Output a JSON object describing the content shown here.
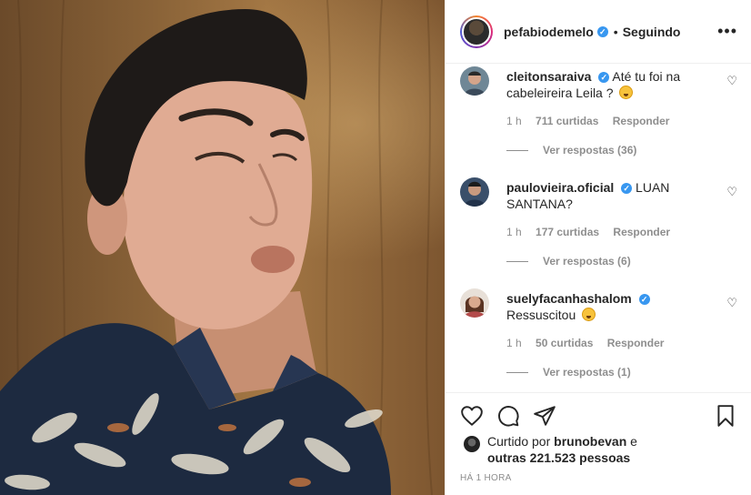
{
  "post": {
    "author": "pefabiodemelo",
    "follow_state": "Seguindo",
    "separator": "•",
    "more_label": "•••",
    "verified_mark": "✓",
    "time_ago": "HÁ 1 HORA"
  },
  "comments": [
    {
      "username": "cleitonsaraiva",
      "verified": true,
      "text": "Até tu foi na cabeleireira Leila ?",
      "emoji": "astonished-face-emoji",
      "time": "1 h",
      "likes": "711 curtidas",
      "reply_label": "Responder",
      "view_replies": "Ver respostas (36)"
    },
    {
      "username": "paulovieira.oficial",
      "verified": true,
      "text": "LUAN SANTANA?",
      "emoji": "",
      "time": "1 h",
      "likes": "177 curtidas",
      "reply_label": "Responder",
      "view_replies": "Ver respostas (6)"
    },
    {
      "username": "suelyfacanhashalom",
      "verified": true,
      "text": "Ressuscitou",
      "emoji": "grinning-squinting-face-emoji",
      "time": "1 h",
      "likes": "50 curtidas",
      "reply_label": "Responder",
      "view_replies": "Ver respostas (1)"
    }
  ],
  "likes_summary": {
    "prefix": "Curtido por",
    "liker": "brunobevan",
    "conjunction": "e",
    "others": "outras 221.523 pessoas"
  },
  "icons": {
    "like": "heart-icon",
    "comment": "comment-bubble-icon",
    "share": "paper-plane-icon",
    "save": "bookmark-icon",
    "comment_like": "small-heart-icon"
  },
  "colors": {
    "verified_blue": "#3897f0",
    "muted_text": "#8e8e8e",
    "primary_text": "#262626",
    "border": "#efefef"
  }
}
